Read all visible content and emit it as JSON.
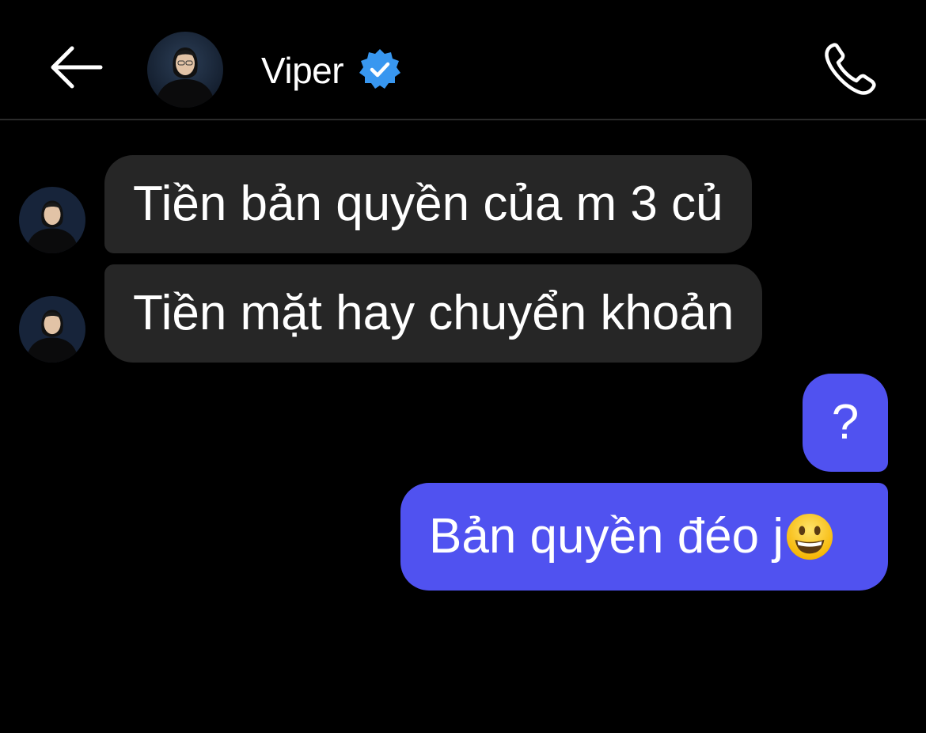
{
  "header": {
    "contact_name": "Viper",
    "back_icon": "arrow-left-icon",
    "call_icon": "phone-icon",
    "verified_icon": "verified-badge-icon"
  },
  "messages": [
    {
      "direction": "incoming",
      "text": "Tiền bản quyền của m 3 củ"
    },
    {
      "direction": "incoming",
      "text": "Tiền mặt hay chuyển khoản"
    },
    {
      "direction": "outgoing",
      "text": "?"
    },
    {
      "direction": "outgoing",
      "text": "Bản quyền đéo j",
      "emoji": "grinning-face-icon"
    }
  ],
  "colors": {
    "background": "#000000",
    "incoming_bubble": "#262626",
    "outgoing_bubble": "#5052f0",
    "verified_badge": "#3897f0"
  }
}
